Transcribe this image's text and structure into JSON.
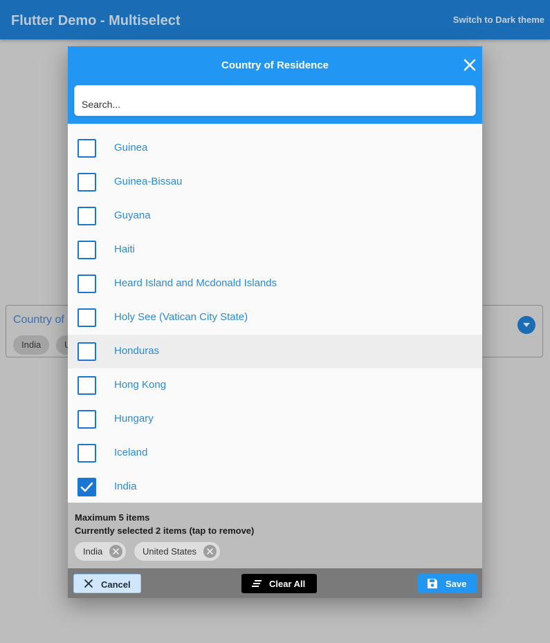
{
  "app_bar": {
    "title": "Flutter Demo - Multiselect",
    "theme_toggle": "Switch to Dark theme"
  },
  "background_field": {
    "label": "Country of",
    "chips": [
      "India",
      "U"
    ]
  },
  "dialog": {
    "title": "Country of Residence",
    "search_placeholder": "Search...",
    "items": [
      {
        "label": "Guinea",
        "checked": false
      },
      {
        "label": "Guinea-Bissau",
        "checked": false
      },
      {
        "label": "Guyana",
        "checked": false
      },
      {
        "label": "Haiti",
        "checked": false
      },
      {
        "label": "Heard Island and Mcdonald Islands",
        "checked": false
      },
      {
        "label": "Holy See (Vatican City State)",
        "checked": false
      },
      {
        "label": "Honduras",
        "checked": false
      },
      {
        "label": "Hong Kong",
        "checked": false
      },
      {
        "label": "Hungary",
        "checked": false
      },
      {
        "label": "Iceland",
        "checked": false
      },
      {
        "label": "India",
        "checked": true
      }
    ],
    "max_text": "Maximum 5 items",
    "selected_text": "Currently selected 2 items (tap to remove)",
    "selected_chips": [
      "India",
      "United States"
    ],
    "buttons": {
      "cancel": "Cancel",
      "clear_all": "Clear All",
      "save": "Save"
    }
  },
  "colors": {
    "app_bar": "#1a6db5",
    "dialog_header": "#2196f3",
    "item_text": "#2a8ad4",
    "checkbox": "#1976d2"
  }
}
